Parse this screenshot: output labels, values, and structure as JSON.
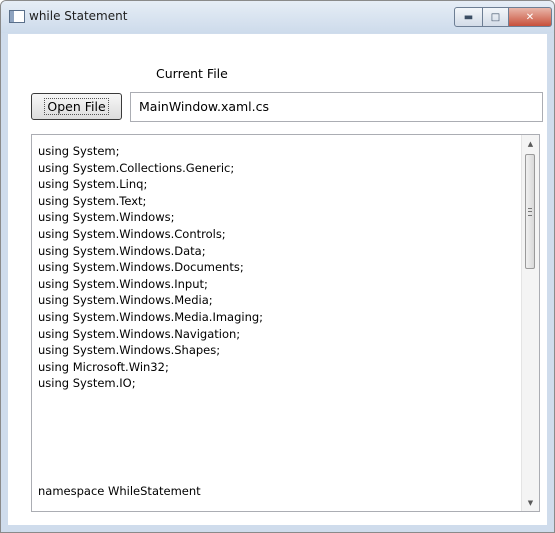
{
  "window": {
    "title": "while Statement",
    "controls": {
      "minimize_icon": "minimize-icon",
      "maximize_icon": "maximize-icon",
      "close_icon": "close-icon"
    }
  },
  "header": {
    "current_file_label": "Current File"
  },
  "toolbar": {
    "open_file_label": "Open File"
  },
  "file_field": {
    "value": "MainWindow.xaml.cs"
  },
  "code": {
    "lines": [
      "using System;",
      "using System.Collections.Generic;",
      "using System.Linq;",
      "using System.Text;",
      "using System.Windows;",
      "using System.Windows.Controls;",
      "using System.Windows.Data;",
      "using System.Windows.Documents;",
      "using System.Windows.Input;",
      "using System.Windows.Media;",
      "using System.Windows.Media.Imaging;",
      "using System.Windows.Navigation;",
      "using System.Windows.Shapes;",
      "using Microsoft.Win32;",
      "using System.IO;"
    ],
    "namespace_line": "namespace WhileStatement"
  }
}
